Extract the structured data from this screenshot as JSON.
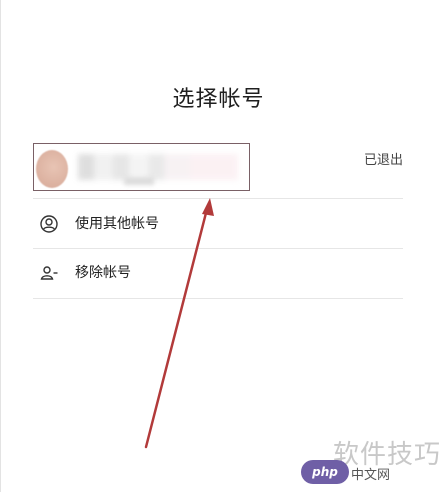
{
  "dialog": {
    "title": "选择帐号",
    "account": {
      "status": "已退出"
    },
    "menu": [
      {
        "label": "使用其他帐号",
        "icon": "person-circle-icon"
      },
      {
        "label": "移除帐号",
        "icon": "remove-person-icon"
      }
    ]
  },
  "watermark": {
    "badge": "php",
    "site": "中文网",
    "text": "软件技巧"
  },
  "colors": {
    "annotation_arrow": "#b23a3a",
    "account_border": "#7a6066",
    "watermark_badge": "#6f5fa6"
  }
}
